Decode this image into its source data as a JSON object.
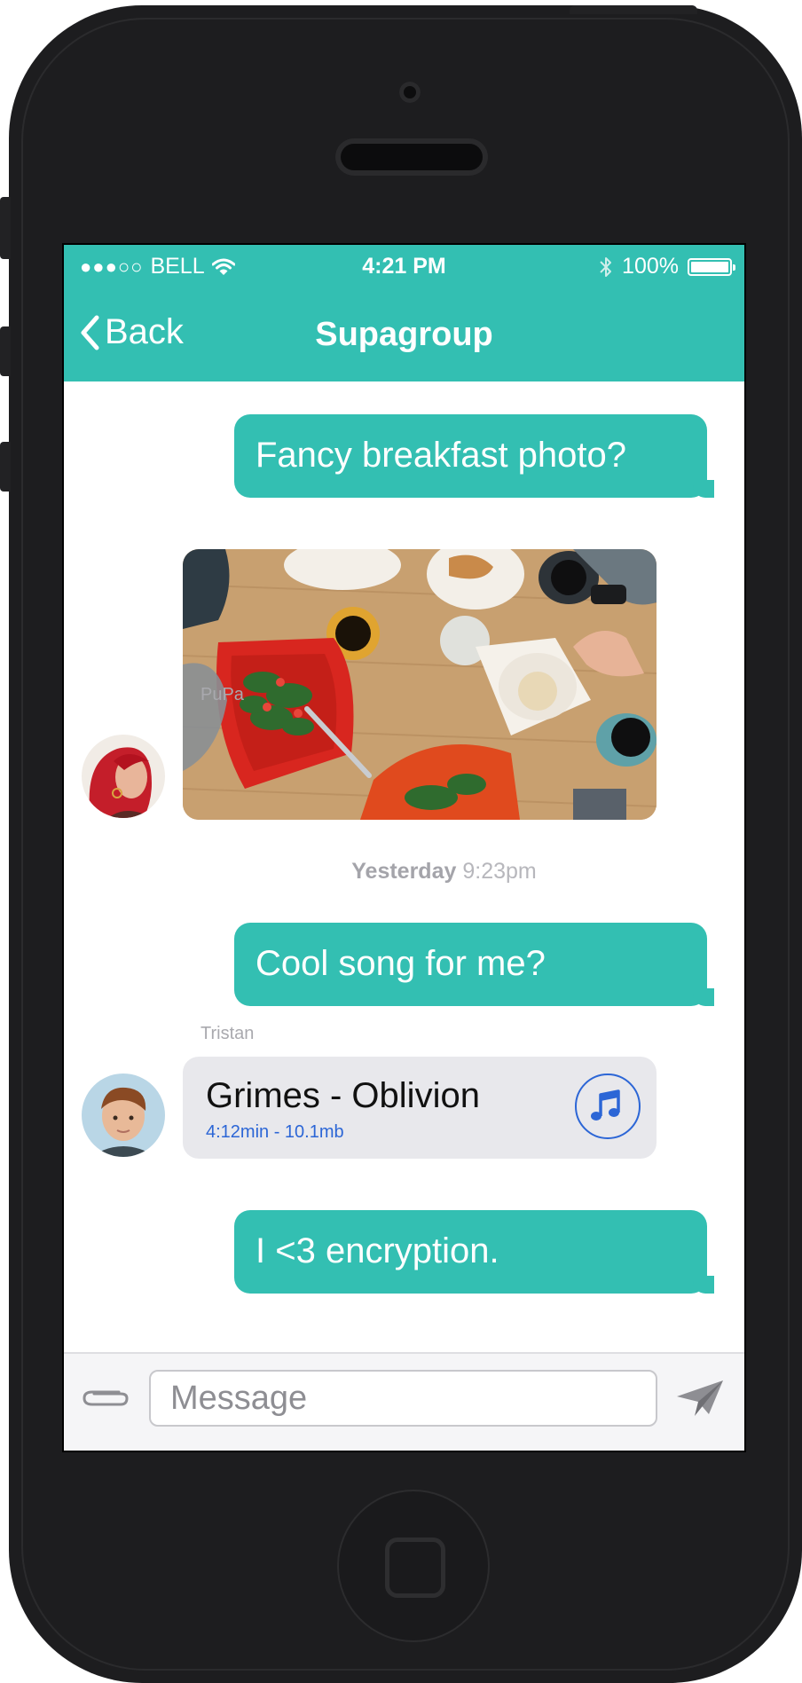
{
  "status_bar": {
    "signal": "●●●○○",
    "carrier": "BELL",
    "time": "4:21 PM",
    "battery_percent": "100%"
  },
  "nav": {
    "back_label": "Back",
    "title": "Supagroup"
  },
  "messages": [
    {
      "type": "outgoing",
      "text": "Fancy breakfast photo?"
    },
    {
      "type": "incoming_image",
      "sender": "PuPa",
      "image": "breakfast table photo"
    },
    {
      "type": "timestamp",
      "day": "Yesterday",
      "time": "9:23pm"
    },
    {
      "type": "outgoing",
      "text": "Cool song for me?"
    },
    {
      "type": "incoming_audio",
      "sender": "Tristan",
      "title": "Grimes - Oblivion",
      "meta": "4:12min - 10.1mb",
      "icon": "music-note-icon"
    },
    {
      "type": "outgoing",
      "text": "I <3 encryption."
    }
  ],
  "composer": {
    "placeholder": "Message",
    "value": ""
  },
  "colors": {
    "accent": "#33bfb2",
    "link_blue": "#2c66d6",
    "incoming_bubble": "#e8e8ec"
  }
}
